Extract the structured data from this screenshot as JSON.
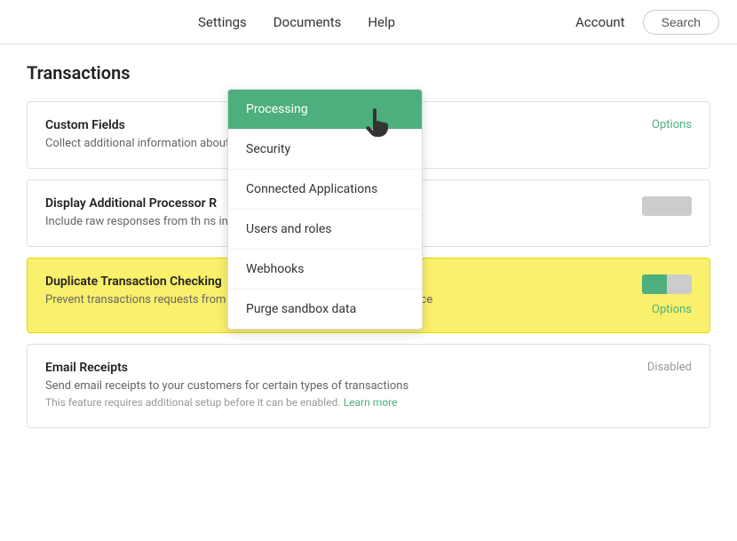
{
  "nav": {
    "settings_label": "Settings",
    "documents_label": "Documents",
    "help_label": "Help",
    "account_label": "Account",
    "search_label": "Search"
  },
  "page": {
    "title": "Transactions"
  },
  "dropdown": {
    "items": [
      {
        "id": "processing",
        "label": "Processing",
        "active": true
      },
      {
        "id": "security",
        "label": "Security",
        "active": false
      },
      {
        "id": "connected-applications",
        "label": "Connected Applications",
        "active": false
      },
      {
        "id": "users-and-roles",
        "label": "Users and roles",
        "active": false
      },
      {
        "id": "webhooks",
        "label": "Webhooks",
        "active": false
      },
      {
        "id": "purge-sandbox-data",
        "label": "Purge sandbox data",
        "active": false
      }
    ]
  },
  "sections": {
    "custom_fields": {
      "title": "Custom Fields",
      "description": "Collect additional information",
      "description_suffix": "about your purchases",
      "options_label": "Options"
    },
    "display_additional": {
      "title": "Display Additional Processor R",
      "description": "Include raw responses from th",
      "description_suffix": "ns in the Control Panel",
      "toggle_state": "off"
    },
    "duplicate_transaction": {
      "title": "Duplicate Transaction Checking",
      "description": "Prevent transactions requests from accidentally processing more than once",
      "options_label": "Options",
      "toggle_state": "on"
    },
    "email_receipts": {
      "title": "Email Receipts",
      "description": "Send email receipts to your customers for certain types of transactions",
      "note": "This feature requires additional setup before it can be enabled.",
      "learn_more": "Learn more",
      "status": "Disabled"
    }
  }
}
